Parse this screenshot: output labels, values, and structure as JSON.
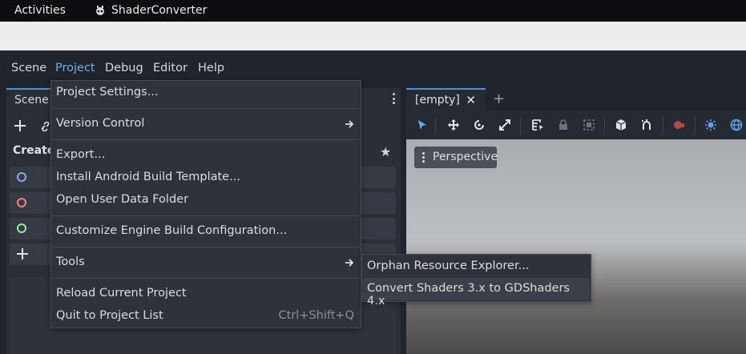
{
  "topbar": {
    "activities": "Activities",
    "app_name": "ShaderConverter"
  },
  "menubar": {
    "items": [
      "Scene",
      "Project",
      "Debug",
      "Editor",
      "Help"
    ],
    "active": "Project"
  },
  "scene_dock": {
    "tab": "Scene",
    "create_label": "Create",
    "rows": [
      {
        "icon": "node2d-ring-icon",
        "color": "#8da5f3"
      },
      {
        "icon": "node3d-ring-icon",
        "color": "#fc7f7f"
      },
      {
        "icon": "control-ring-icon",
        "color": "#8eef97"
      },
      {
        "icon": "plus-icon"
      }
    ]
  },
  "editor": {
    "tab": "[empty]",
    "close_glyph": "✕",
    "add_tab_glyph": "+",
    "perspective": "Perspective"
  },
  "project_menu": {
    "items": [
      {
        "label": "Project Settings..."
      },
      {
        "label": "Version Control",
        "submenu": true
      },
      {
        "label": "Export..."
      },
      {
        "label": "Install Android Build Template..."
      },
      {
        "label": "Open User Data Folder"
      },
      {
        "label": "Customize Engine Build Configuration..."
      },
      {
        "label": "Tools",
        "submenu": true
      },
      {
        "label": "Reload Current Project"
      },
      {
        "label": "Quit to Project List",
        "shortcut": "Ctrl+Shift+Q"
      }
    ]
  },
  "tools_submenu": {
    "items": [
      "Orphan Resource Explorer...",
      "Convert Shaders 3.x to GDShaders 4.x"
    ],
    "highlighted": "Convert Shaders 3.x to GDShaders 4.x"
  },
  "colors": {
    "accent": "#70aeea",
    "tab_border": "#4e90d8",
    "menu_bg": "#2e323b"
  }
}
